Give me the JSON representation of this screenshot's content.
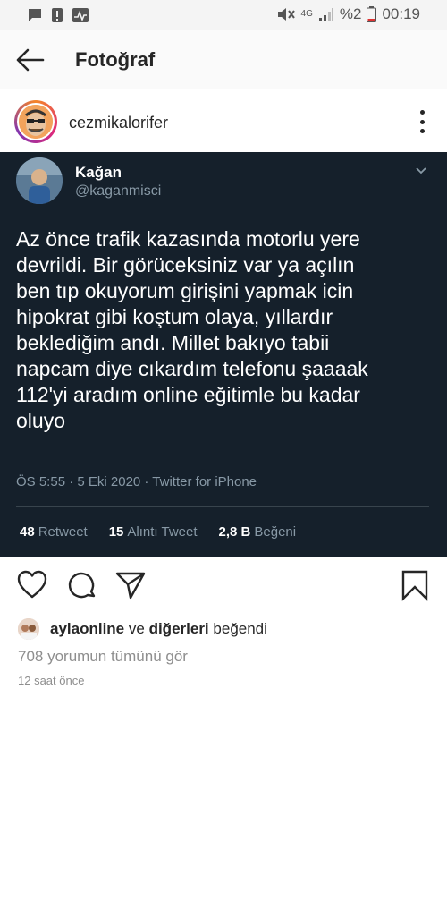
{
  "status_bar": {
    "network": "4G",
    "battery_percent": "%2",
    "time": "00:19"
  },
  "header": {
    "title": "Fotoğraf"
  },
  "post": {
    "username": "cezmikalorifer",
    "tweet": {
      "name": "Kağan",
      "handle": "@kaganmisci",
      "text": "Az önce trafik kazasında motorlu yere\ndevrildi. Bir görüceksiniz var ya açılın\nben tıp okuyorum girişini yapmak icin\nhipokrat gibi koştum olaya, yıllardır\nbeklediğim andı. Millet bakıyo tabii\nnapcam diye cıkardım telefonu şaaaak\n112'yi aradım online eğitimle bu kadar\noluyo",
      "meta": "ÖS 5:55 · 5 Eki 2020 · Twitter for iPhone",
      "stats": [
        {
          "count": "48",
          "label": "Retweet"
        },
        {
          "count": "15",
          "label": "Alıntı Tweet"
        },
        {
          "count": "2,8 B",
          "label": "Beğeni"
        }
      ]
    },
    "likes": {
      "liker": "aylaonline",
      "connector": "ve",
      "others": "diğerleri",
      "suffix": "beğendi"
    },
    "comments_link": "708 yorumun tümünü gör",
    "time_ago": "12 saat önce"
  }
}
